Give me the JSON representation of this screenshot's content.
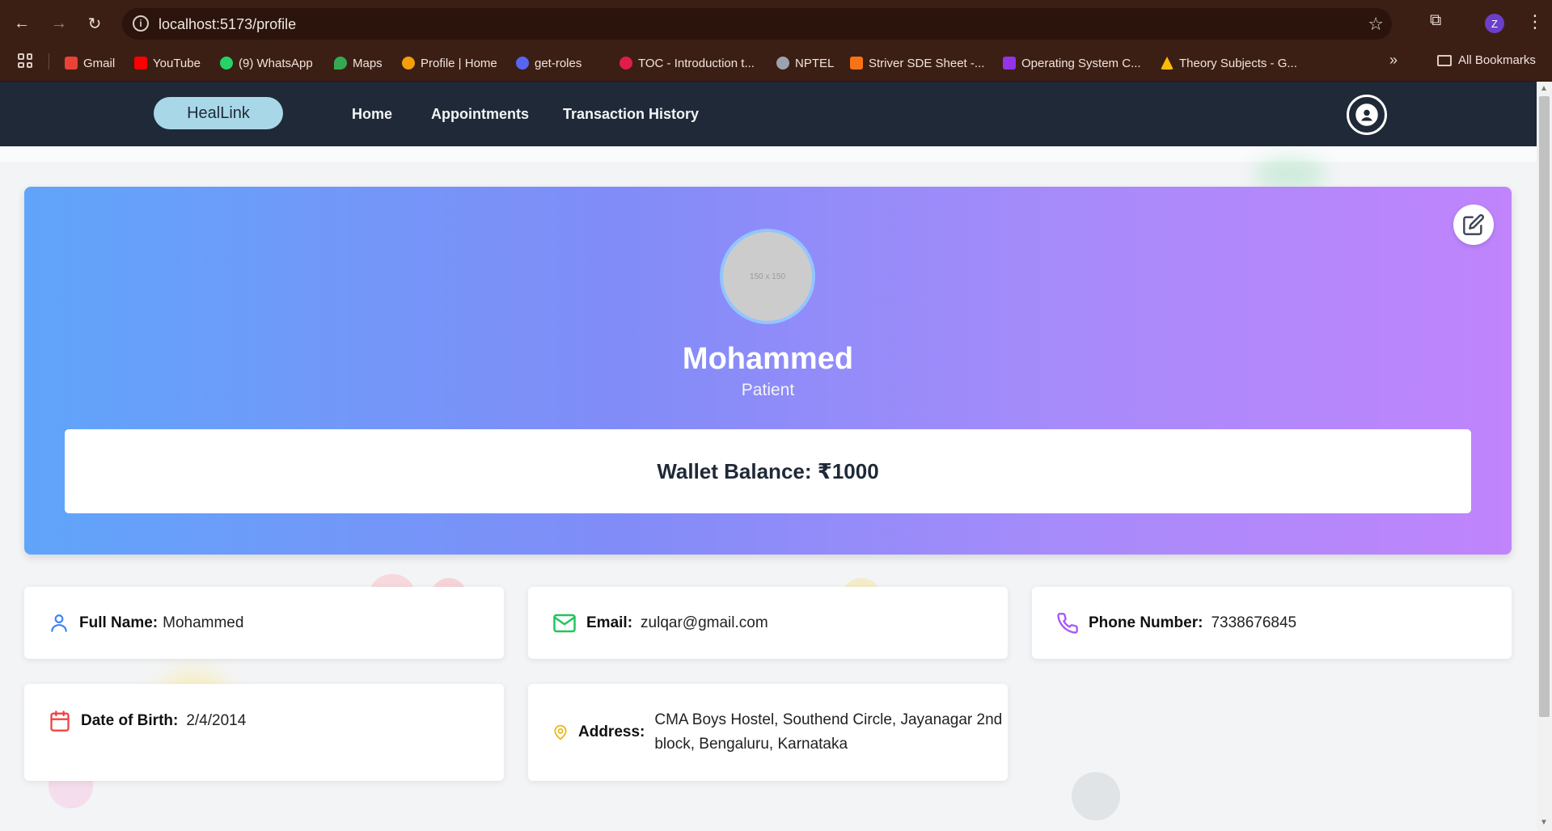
{
  "browser": {
    "url": "localhost:5173/profile",
    "profile_initial": "Z",
    "bookmarks": [
      {
        "label": "Gmail",
        "color": "#ea4335"
      },
      {
        "label": "YouTube",
        "color": "#ff0000"
      },
      {
        "label": "(9) WhatsApp",
        "color": "#25d366"
      },
      {
        "label": "Maps",
        "color": "#34a853"
      },
      {
        "label": "Profile | Home",
        "color": "#f59e0b"
      },
      {
        "label": "get-roles",
        "color": "#5865f2"
      },
      {
        "label": "TOC - Introduction t...",
        "color": "#e11d48"
      },
      {
        "label": "NPTEL",
        "color": "#9ca3af"
      },
      {
        "label": "Striver SDE Sheet -...",
        "color": "#f97316"
      },
      {
        "label": "Operating System C...",
        "color": "#9333ea"
      },
      {
        "label": "Theory Subjects - G...",
        "color": "#fbbc04"
      }
    ],
    "all_bookmarks": "All Bookmarks"
  },
  "nav": {
    "logo": "HealLink",
    "links": [
      "Home",
      "Appointments",
      "Transaction History"
    ]
  },
  "profile": {
    "avatar_placeholder": "150 x 150",
    "name": "Mohammed",
    "role": "Patient",
    "wallet": "Wallet Balance: ₹1000"
  },
  "details": {
    "full_name_label": "Full Name:",
    "full_name": "Mohammed",
    "email_label": "Email:",
    "email": "zulqar@gmail.com",
    "phone_label": "Phone Number:",
    "phone": "7338676845",
    "dob_label": "Date of Birth:",
    "dob": "2/4/2014",
    "address_label": "Address:",
    "address": "CMA Boys Hostel, Southend Circle, Jayanagar 2nd block, Bengaluru, Karnataka"
  },
  "colors": {
    "accent_blue": "#3b82f6",
    "accent_green": "#22c55e",
    "accent_purple": "#a855f7",
    "accent_red": "#ef4444",
    "accent_yellow": "#eab308"
  }
}
